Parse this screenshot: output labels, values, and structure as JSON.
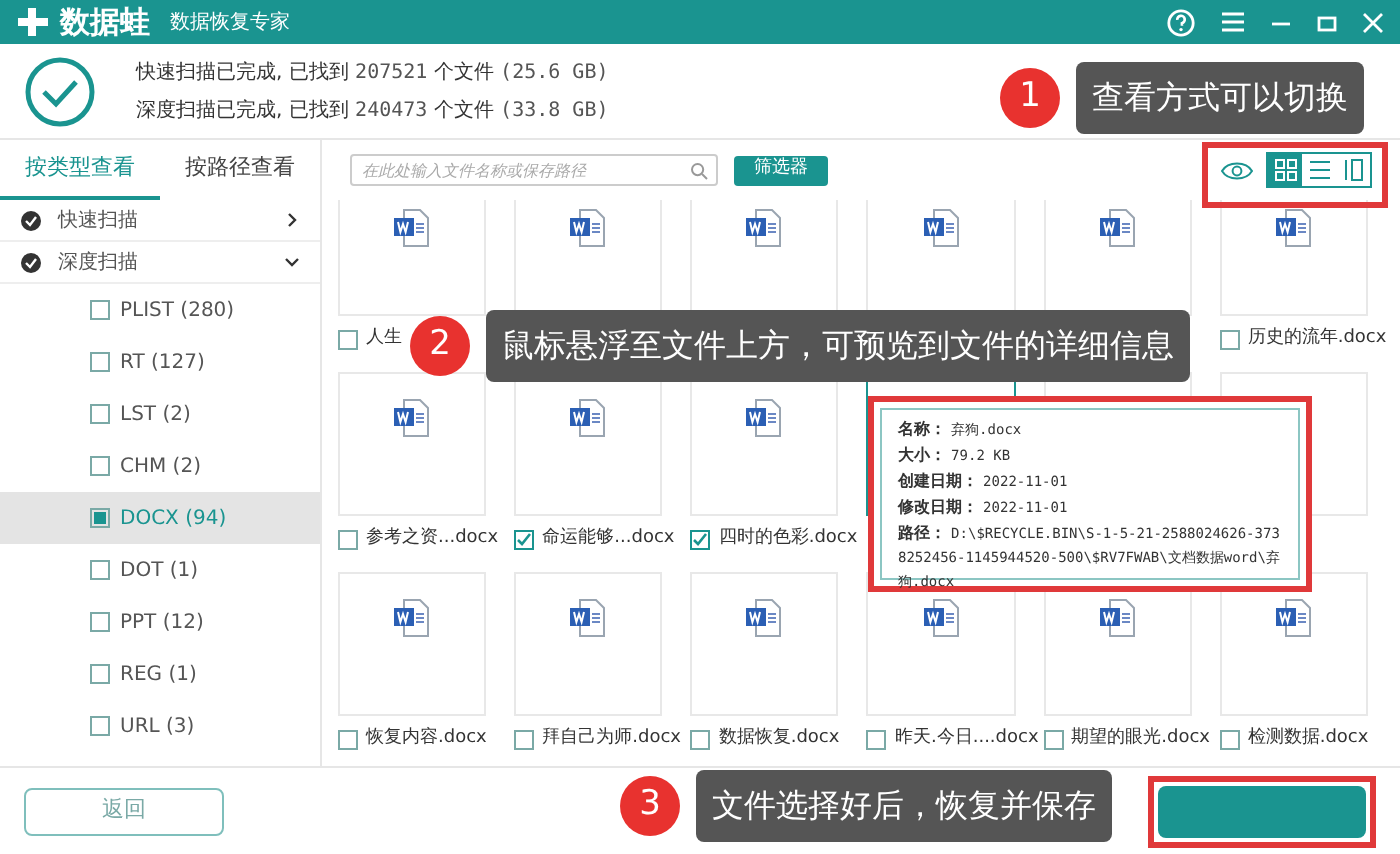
{
  "window": {
    "logo": "数据蛙",
    "subtitle": "数据恢复专家"
  },
  "scan_summary": [
    {
      "text": "快速扫描已完成, 已找到",
      "count": "207521",
      "unit": "个文件",
      "size": "(25.6 GB)"
    },
    {
      "text": "深度扫描已完成, 已找到",
      "count": "240473",
      "unit": "个文件",
      "size": "(33.8 GB)"
    }
  ],
  "sidebar": {
    "tabs": [
      {
        "label": "按类型查看",
        "selected": true
      },
      {
        "label": "按路径查看",
        "selected": false
      }
    ],
    "groups": [
      {
        "label": "快速扫描",
        "expanded": false
      },
      {
        "label": "深度扫描",
        "expanded": true,
        "children": [
          {
            "label": "PLIST (280)",
            "checked": false,
            "selected": false
          },
          {
            "label": "RT (127)",
            "checked": false,
            "selected": false
          },
          {
            "label": "LST (2)",
            "checked": false,
            "selected": false
          },
          {
            "label": "CHM (2)",
            "checked": false,
            "selected": false
          },
          {
            "label": "DOCX (94)",
            "checked": true,
            "selected": true
          },
          {
            "label": "DOT (1)",
            "checked": false,
            "selected": false
          },
          {
            "label": "PPT (12)",
            "checked": false,
            "selected": false
          },
          {
            "label": "REG (1)",
            "checked": false,
            "selected": false
          },
          {
            "label": "URL (3)",
            "checked": false,
            "selected": false
          }
        ]
      }
    ]
  },
  "toolbar": {
    "search": {
      "placeholder": "在此处输入文件名称或保存路径"
    },
    "filter_button": "筛选器",
    "view_modes": [
      {
        "kind": "grid",
        "selected": true
      },
      {
        "kind": "list",
        "selected": false
      },
      {
        "kind": "detail",
        "selected": false
      }
    ]
  },
  "file_rows": [
    [
      {
        "label": "人生",
        "checked": false
      },
      {},
      {},
      {},
      {},
      {
        "label": "历史的流年.docx",
        "checked": false
      }
    ],
    [
      {
        "label": "参考之资...docx",
        "checked": false
      },
      {
        "label": "命运能够...docx",
        "checked": true
      },
      {
        "label": "四时的色彩.docx",
        "checked": true
      },
      {
        "hovered": true
      },
      {},
      {}
    ],
    [
      {
        "label": "恢复内容.docx",
        "checked": false
      },
      {
        "label": "拜自己为师.docx",
        "checked": false
      },
      {
        "label": "数据恢复.docx",
        "checked": false
      },
      {
        "label": "昨天.今日....docx",
        "checked": false
      },
      {
        "label": "期望的眼光.docx",
        "checked": false
      },
      {
        "label": "检测数据.docx",
        "checked": false
      }
    ]
  ],
  "preview": {
    "fields": [
      {
        "label": "名称：",
        "value": "弃狗.docx"
      },
      {
        "label": "大小：",
        "value": "79.2 KB"
      },
      {
        "label": "创建日期：",
        "value": "2022-11-01"
      },
      {
        "label": "修改日期：",
        "value": "2022-11-01"
      },
      {
        "label": "路径：",
        "value": "D:\\$RECYCLE.BIN\\S-1-5-21-2588024626-3738252456-1145944520-500\\$RV7FWAB\\文档数据word\\弃狗.docx"
      }
    ]
  },
  "back_button": "返回",
  "callouts": [
    {
      "number": "1",
      "text": "查看方式可以切换"
    },
    {
      "number": "2",
      "text": "鼠标悬浮至文件上方，可预览到文件的详细信息"
    },
    {
      "number": "3",
      "text": "文件选择好后，恢复并保存"
    }
  ]
}
